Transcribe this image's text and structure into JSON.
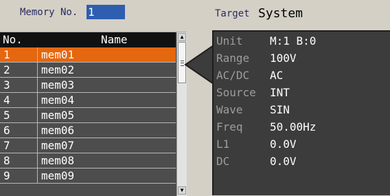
{
  "header": {
    "memory_label": "Memory No.",
    "memory_value": "1",
    "target_label": "Target",
    "target_value": "System"
  },
  "list": {
    "columns": {
      "no": "No.",
      "name": "Name"
    },
    "rows": [
      {
        "no": "1",
        "name": "mem01",
        "selected": true
      },
      {
        "no": "2",
        "name": "mem02"
      },
      {
        "no": "3",
        "name": "mem03"
      },
      {
        "no": "4",
        "name": "mem04"
      },
      {
        "no": "5",
        "name": "mem05"
      },
      {
        "no": "6",
        "name": "mem06"
      },
      {
        "no": "7",
        "name": "mem07"
      },
      {
        "no": "8",
        "name": "mem08"
      },
      {
        "no": "9",
        "name": "mem09"
      }
    ]
  },
  "detail": {
    "rows": [
      {
        "key": "Unit",
        "value": "M:1 B:0"
      },
      {
        "key": "Range",
        "value": "100V"
      },
      {
        "key": "AC/DC",
        "value": "AC"
      },
      {
        "key": "Source",
        "value": "INT"
      },
      {
        "key": "Wave",
        "value": "SIN"
      },
      {
        "key": "Freq",
        "value": "50.00Hz"
      },
      {
        "key": "L1",
        "value": "0.0V"
      },
      {
        "key": "DC",
        "value": "0.0V"
      }
    ]
  },
  "colors": {
    "selected_row": "#e5670f",
    "memory_field": "#2e5eb0",
    "list_bg": "#4d4d4d",
    "detail_bg": "#3c3c3c"
  },
  "icons": {
    "scroll_up": "up-arrow",
    "scroll_down": "down-arrow"
  }
}
